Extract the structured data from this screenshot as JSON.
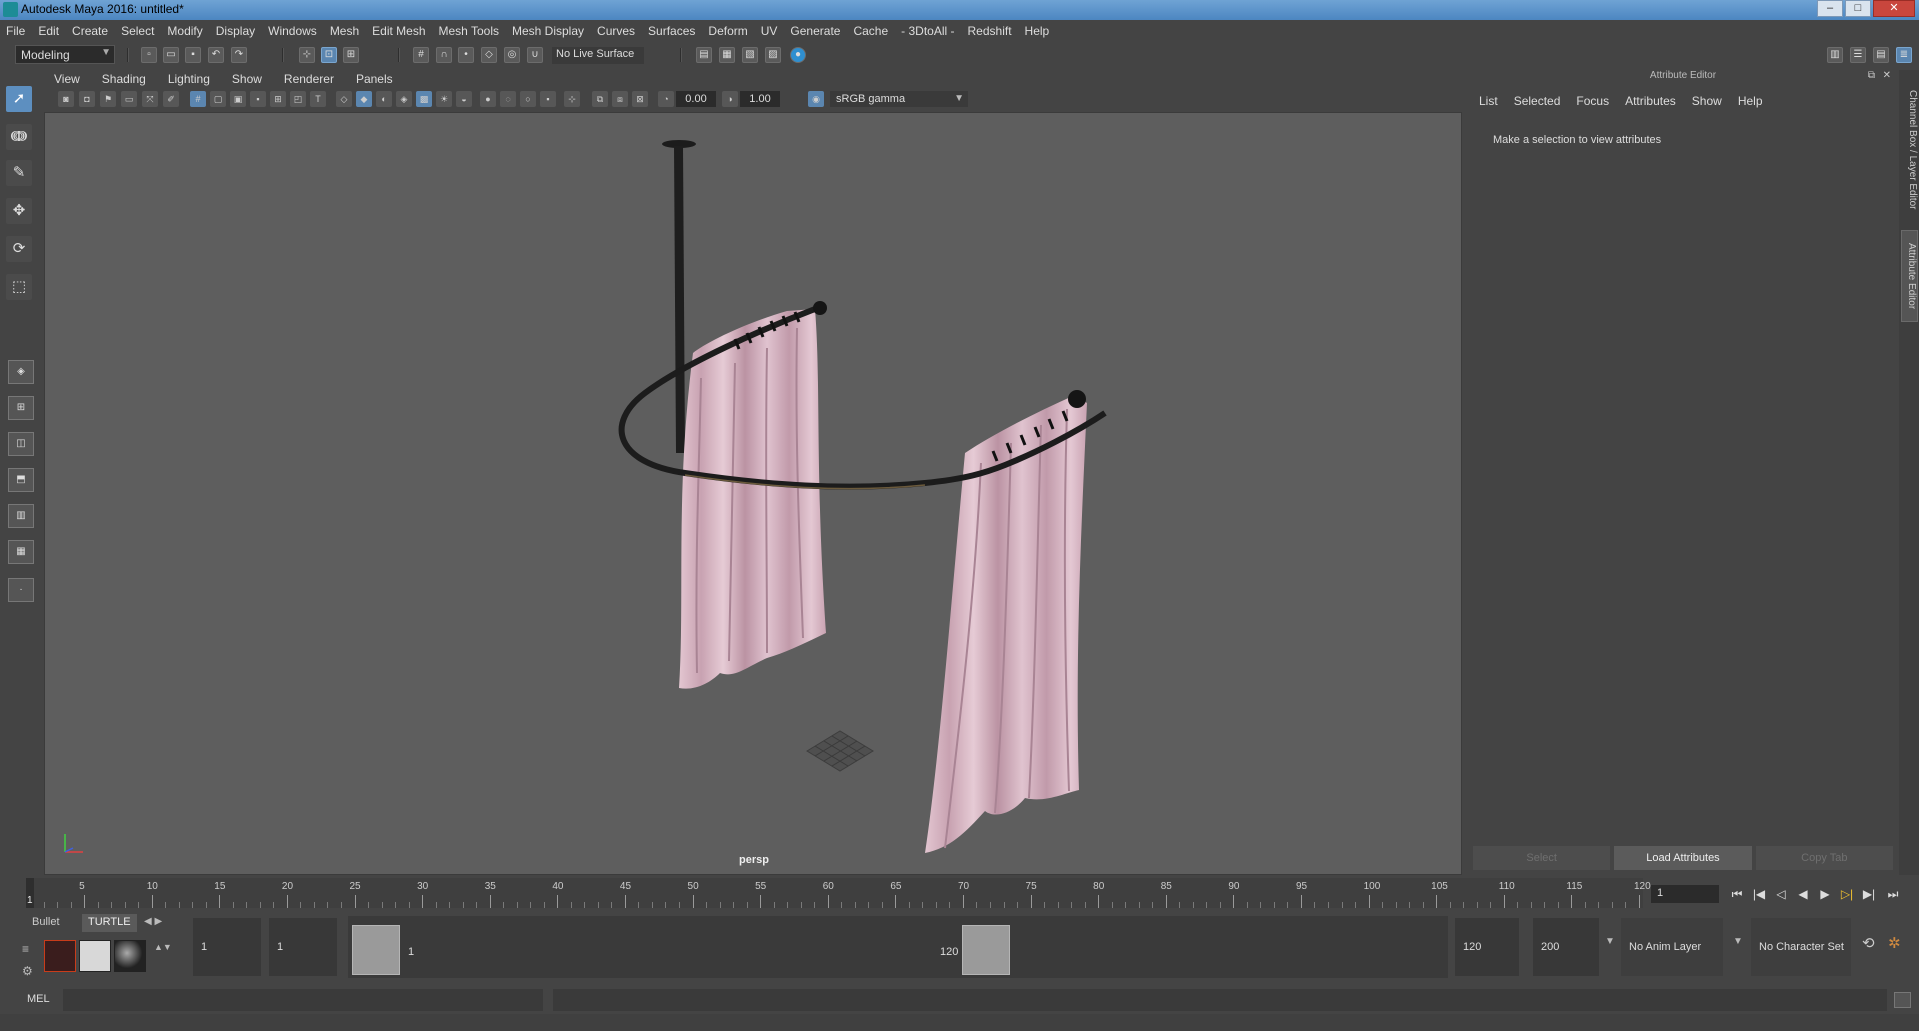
{
  "window": {
    "title": "Autodesk Maya 2016: untitled*",
    "controls": [
      "–",
      "□",
      "✕"
    ]
  },
  "menubar": {
    "items": [
      "File",
      "Edit",
      "Create",
      "Select",
      "Modify",
      "Display",
      "Windows",
      "Mesh",
      "Edit Mesh",
      "Mesh Tools",
      "Mesh Display",
      "Curves",
      "Surfaces",
      "Deform",
      "UV",
      "Generate",
      "Cache",
      "- 3DtoAll -",
      "Redshift",
      "Help"
    ]
  },
  "statusline": {
    "mode": "Modeling",
    "live_surface": "No Live Surface"
  },
  "viewport": {
    "menu": [
      "View",
      "Shading",
      "Lighting",
      "Show",
      "Renderer",
      "Panels"
    ],
    "gamma_field": "0.00",
    "exposure_field": "1.00",
    "color_space": "sRGB gamma",
    "camera": "persp"
  },
  "attribute_editor": {
    "title": "Attribute Editor",
    "menu": [
      "List",
      "Selected",
      "Focus",
      "Attributes",
      "Show",
      "Help"
    ],
    "message": "Make a selection to view attributes",
    "buttons": [
      "Select",
      "Load Attributes",
      "Copy Tab"
    ]
  },
  "side_tabs": [
    "Channel Box / Layer Editor",
    "Attribute Editor"
  ],
  "timeline": {
    "ticks": [
      "5",
      "10",
      "15",
      "20",
      "25",
      "30",
      "35",
      "40",
      "45",
      "50",
      "55",
      "60",
      "65",
      "70",
      "75",
      "80",
      "85",
      "90",
      "95",
      "100",
      "105",
      "110",
      "115",
      "120"
    ],
    "current_frame": "1",
    "current_frame_field": "1"
  },
  "shelf": {
    "tabs": [
      "Bullet",
      "TURTLE"
    ]
  },
  "range": {
    "start": "1",
    "playback_start": "1",
    "slider_start": "1",
    "slider_end": "120",
    "playback_end": "120",
    "end": "200",
    "anim_layer": "No Anim Layer",
    "character_set": "No Character Set"
  },
  "commandline": {
    "label": "MEL"
  },
  "colors": {
    "curtain": "#d8b5c3",
    "rod": "#1c1c1c",
    "viewport_bg": "#5e5e5e",
    "accent": "#5b86b0"
  }
}
